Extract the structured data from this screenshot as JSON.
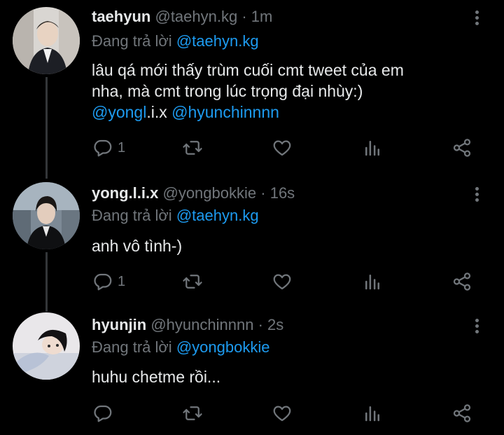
{
  "tweets": [
    {
      "name": "taehyun",
      "handle": "@taehyn.kg",
      "dot": "·",
      "time": "1m",
      "reply_prefix": "Đang trả lời",
      "reply_to": "@taehyn.kg",
      "text_line1": "lâu qá mới thấy trùm cuối cmt tweet của em",
      "text_line2": "nha, mà cmt trong lúc trọng đại nhùy:)",
      "mention1_link": "@yongl",
      "mention1_rest": ".i.x",
      "mention2": "@hyunchinnnn",
      "reply_count": "1"
    },
    {
      "name": "yong.l.i.x",
      "handle": "@yongbokkie",
      "dot": "·",
      "time": "16s",
      "reply_prefix": "Đang trả lời",
      "reply_to": "@taehyn.kg",
      "text": "anh vô tình-)",
      "reply_count": "1"
    },
    {
      "name": "hyunjin",
      "handle": "@hyunchinnnn",
      "dot": "·",
      "time": "2s",
      "reply_prefix": "Đang trả lời",
      "reply_to": "@yongbokkie",
      "text": "huhu chetme rồi...",
      "reply_count": ""
    }
  ],
  "icons": {
    "reply": "reply-icon",
    "retweet": "retweet-icon",
    "like": "heart-icon",
    "views": "analytics-icon",
    "share": "share-icon",
    "more": "more-vertical-icon"
  },
  "colors": {
    "background": "#000000",
    "text": "#e7e9ea",
    "secondary": "#71767b",
    "link": "#1d9bf0"
  }
}
